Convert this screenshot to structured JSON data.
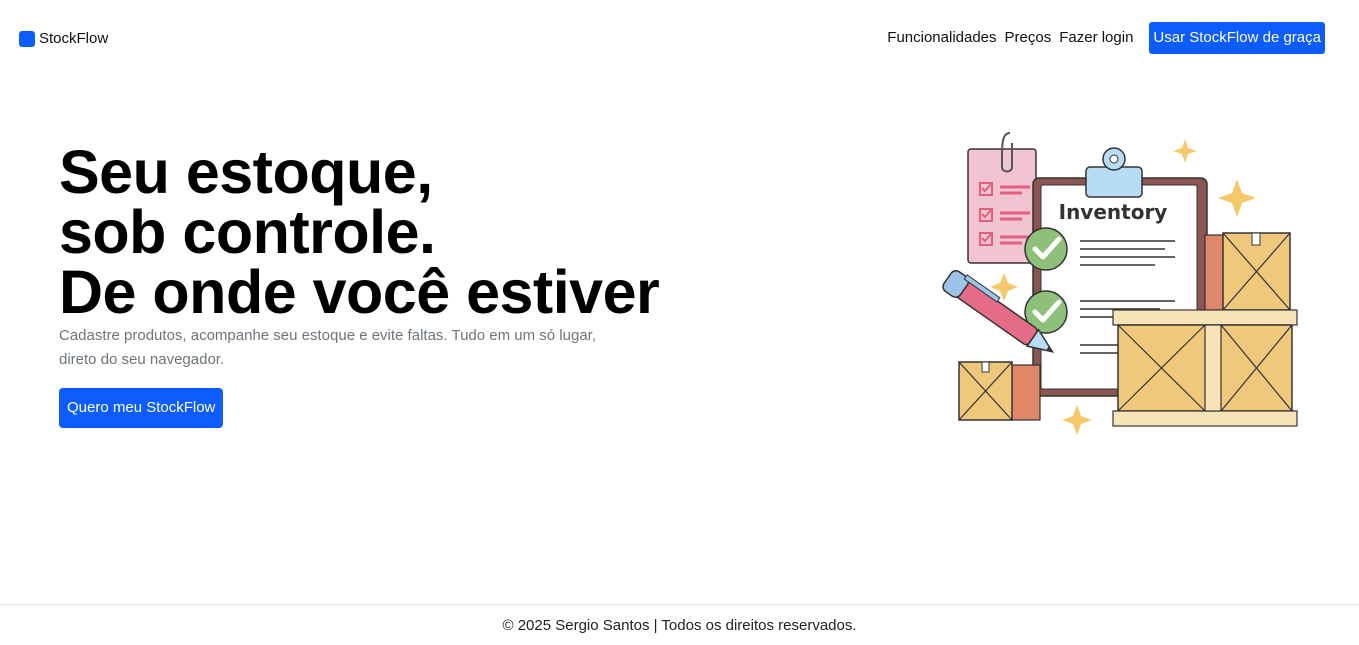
{
  "brand": {
    "name": "StockFlow",
    "icon": "logo-square-icon",
    "color": "#0d5cff"
  },
  "nav": {
    "links": [
      "Funcionalidades",
      "Preços",
      "Fazer login"
    ],
    "cta": "Usar StockFlow de graça"
  },
  "hero": {
    "title_lines": [
      "Seu estoque,",
      "sob controle.",
      "De onde você estiver"
    ],
    "subtitle": "Cadastre produtos, acompanhe seu estoque e evite faltas. Tudo em um só lugar, direto do seu navegador.",
    "cta": "Quero meu StockFlow"
  },
  "illustration": {
    "clipboard_title": "Inventory",
    "icon": "inventory-clipboard-illustration"
  },
  "footer": {
    "text": "© 2025 Sergio Santos | Todos os direitos reservados."
  },
  "colors": {
    "accent": "#0d5cff",
    "muted_text": "#6c757d"
  }
}
